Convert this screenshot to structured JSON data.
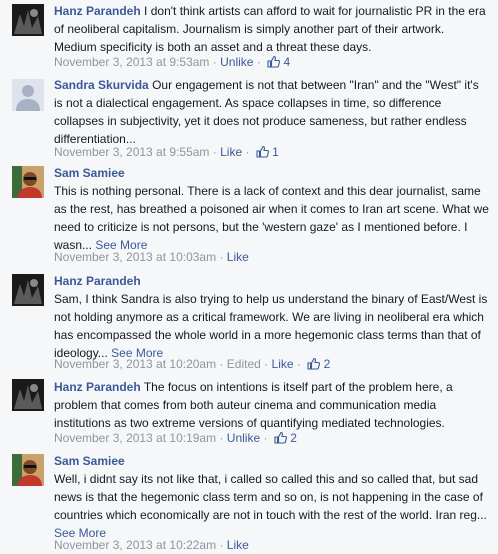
{
  "comments": [
    {
      "author": "Hanz Parandeh",
      "text": "I don't think artists can afford to wait for journalistic PR in the era of neoliberal capitalism. Journalism is simply another part of their artwork. Medium specificity is both an asset and a threat these days.",
      "see_more": "",
      "timestamp": "November 3, 2013 at 9:53am",
      "edited": "",
      "like_action": "Unlike",
      "like_count": "4"
    },
    {
      "author": "Sandra Skurvida",
      "text": "Our engagement is not that between \"Iran\" and the \"West\" it's is not a dialectical engagement. As space collapses in time, so difference collapses in subjectivity, yet it does not produce sameness, but rather endless differentiation...",
      "see_more": "",
      "timestamp": "November 3, 2013 at 9:55am",
      "edited": "",
      "like_action": "Like",
      "like_count": "1"
    },
    {
      "author": "Sam Samiee",
      "text": "This is nothing personal. There is a lack of context and this dear journalist, same as the rest, has breathed a poisoned air when it comes to Iran art scene. What we need to criticize is not persons, but the 'western gaze' as I mentioned before. I wasn...",
      "see_more": "See More",
      "timestamp": "November 3, 2013 at 10:03am",
      "edited": "",
      "like_action": "Like",
      "like_count": ""
    },
    {
      "author": "Hanz Parandeh",
      "text": "Sam, I think Sandra is also trying to help us understand the binary of East/West is not holding anymore as a critical framework. We are living in neoliberal era which has encompassed the whole world in a more hegemonic class terms than that of ideology...",
      "see_more": "See More",
      "timestamp": "November 3, 2013 at 10:20am",
      "edited": "Edited",
      "like_action": "Like",
      "like_count": "2"
    },
    {
      "author": "Hanz Parandeh",
      "text": "The focus on intentions is itself part of the problem here, a problem that comes from both auteur cinema and communication media institutions as two extreme versions of quantifying mediated technologies.",
      "see_more": "",
      "timestamp": "November 3, 2013 at 10:19am",
      "edited": "",
      "like_action": "Unlike",
      "like_count": "2"
    },
    {
      "author": "Sam Samiee",
      "text": "Well, i didnt say its not like that, i called so called this and so called that, but sad news is that the hegemonic class term and so on, is not happening in the case of countries which economically are not in touch with the rest of the world. Iran reg...",
      "see_more": "See More",
      "timestamp": "November 3, 2013 at 10:22am",
      "edited": "",
      "like_action": "Like",
      "like_count": ""
    }
  ],
  "colors": {
    "link": "#3b5998",
    "meta": "#90949c",
    "text": "#141823",
    "background": "#f6f7f9"
  },
  "icons": {
    "like": "thumbs-up-icon"
  }
}
